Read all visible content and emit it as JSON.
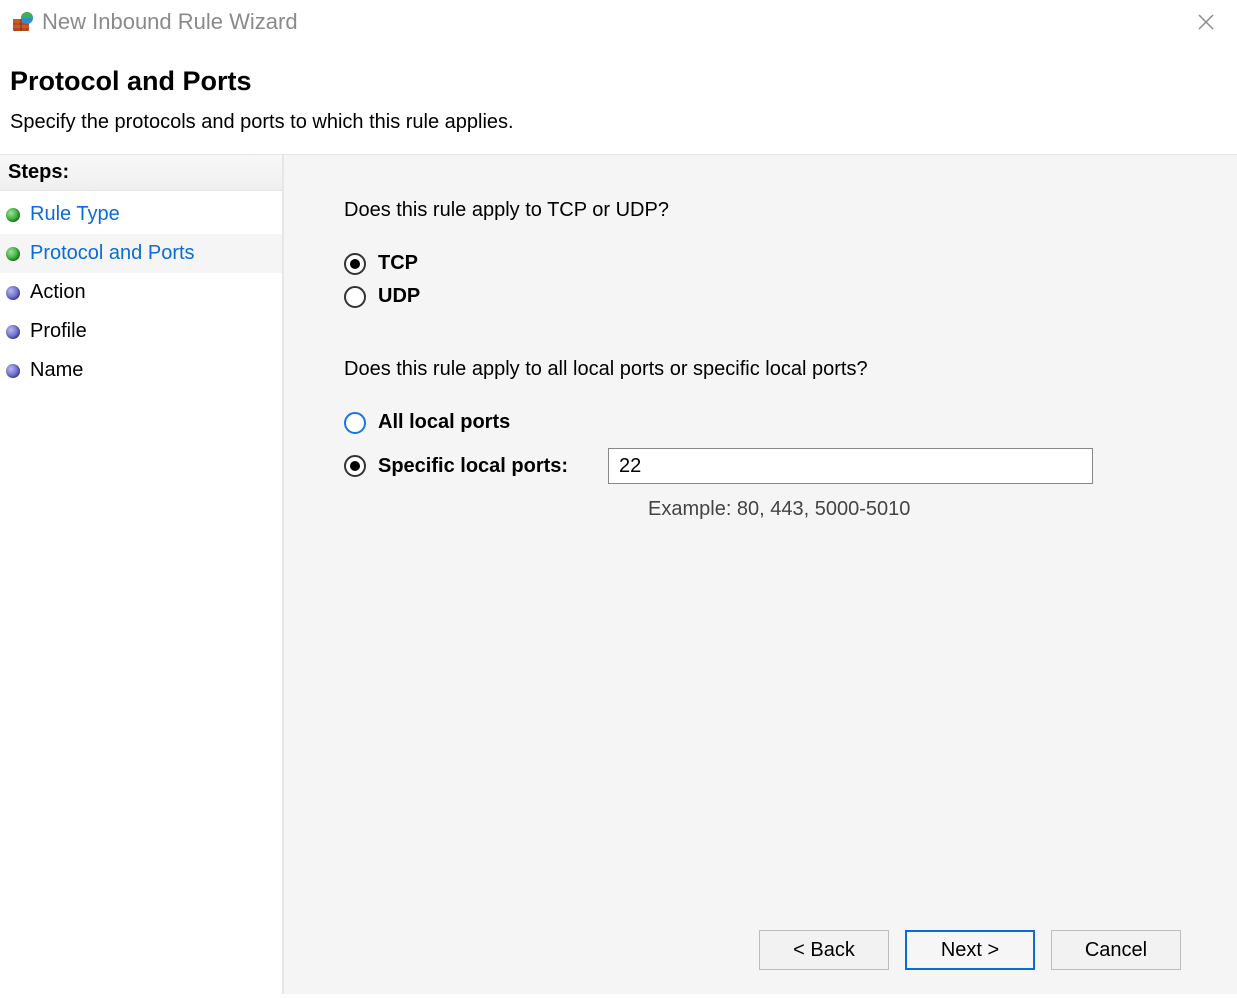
{
  "window": {
    "title": "New Inbound Rule Wizard"
  },
  "header": {
    "title": "Protocol and Ports",
    "subtitle": "Specify the protocols and ports to which this rule applies."
  },
  "sidebar": {
    "heading": "Steps:",
    "items": [
      {
        "label": "Rule Type",
        "state": "completed"
      },
      {
        "label": "Protocol and Ports",
        "state": "current"
      },
      {
        "label": "Action",
        "state": "pending"
      },
      {
        "label": "Profile",
        "state": "pending"
      },
      {
        "label": "Name",
        "state": "pending"
      }
    ]
  },
  "main": {
    "protocol_question": "Does this rule apply to TCP or UDP?",
    "protocol_options": {
      "tcp": "TCP",
      "udp": "UDP",
      "selected": "tcp"
    },
    "ports_question": "Does this rule apply to all local ports or specific local ports?",
    "ports_options": {
      "all_label": "All local ports",
      "specific_label": "Specific local ports:",
      "selected": "specific",
      "value": "22",
      "example": "Example: 80, 443, 5000-5010"
    }
  },
  "buttons": {
    "back": "< Back",
    "next": "Next >",
    "cancel": "Cancel"
  }
}
